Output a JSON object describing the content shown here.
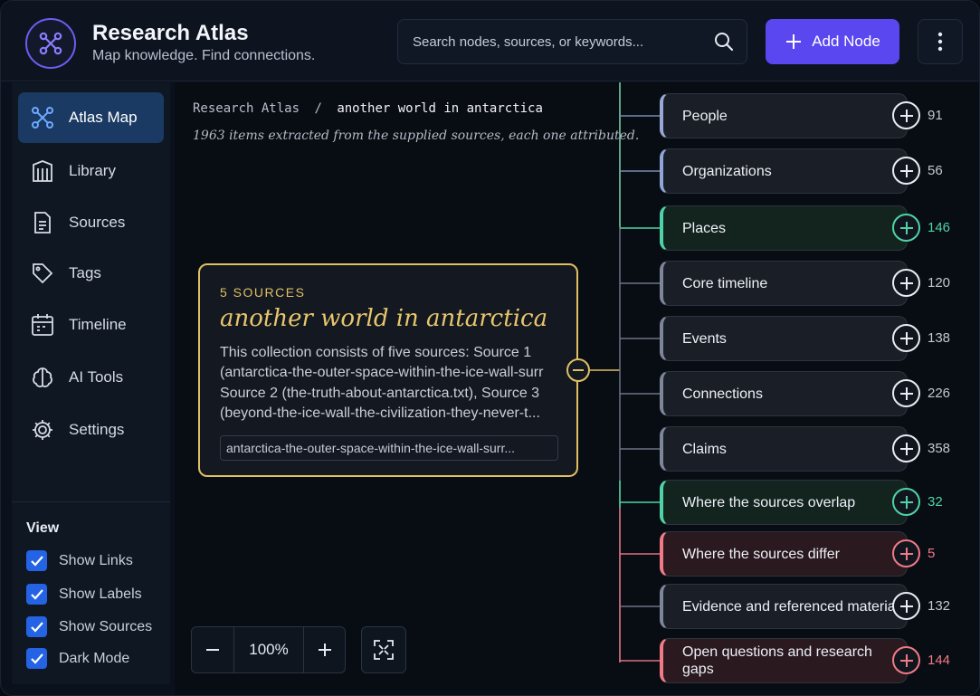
{
  "header": {
    "title": "Research Atlas",
    "subtitle": "Map knowledge. Find connections.",
    "search_placeholder": "Search nodes, sources, or keywords...",
    "add_label": "Add Node"
  },
  "sidebar": {
    "items": [
      {
        "label": "Atlas Map",
        "icon": "network-icon"
      },
      {
        "label": "Library",
        "icon": "library-icon"
      },
      {
        "label": "Sources",
        "icon": "document-icon"
      },
      {
        "label": "Tags",
        "icon": "tag-icon"
      },
      {
        "label": "Timeline",
        "icon": "calendar-icon"
      },
      {
        "label": "AI Tools",
        "icon": "ai-icon"
      },
      {
        "label": "Settings",
        "icon": "gear-icon"
      }
    ],
    "view_title": "View",
    "view_options": [
      {
        "label": "Show Links",
        "checked": true
      },
      {
        "label": "Show Labels",
        "checked": true
      },
      {
        "label": "Show Sources",
        "checked": true
      },
      {
        "label": "Dark Mode",
        "checked": true
      }
    ]
  },
  "breadcrumb": {
    "root": "Research Atlas",
    "separator": "/",
    "current": "another world in antarctica"
  },
  "items_note": "1963 items extracted from the supplied sources, each one attributed.",
  "root_node": {
    "kicker": "5 SOURCES",
    "title": "another world in antarctica",
    "desc_lines": [
      "This collection consists of five sources: Source 1",
      "(antarctica-the-outer-space-within-the-ice-wall-surr",
      "Source 2 (the-truth-about-antarctica.txt), Source 3",
      "(beyond-the-ice-wall-the-civilization-they-never-t..."
    ],
    "file": "antarctica-the-outer-space-within-the-ice-wall-surr..."
  },
  "branches": [
    {
      "label": "People",
      "count": "91",
      "accent": "#9aa8d8",
      "tint": "#1a1f27"
    },
    {
      "label": "Organizations",
      "count": "56",
      "accent": "#8fa6d6",
      "tint": "#1a1f27"
    },
    {
      "label": "Places",
      "count": "146",
      "accent": "#4fd3a5",
      "tint": "#13241f"
    },
    {
      "label": "Core timeline",
      "count": "120",
      "accent": "#7d8799",
      "tint": "#1a1f27"
    },
    {
      "label": "Events",
      "count": "138",
      "accent": "#7d8799",
      "tint": "#1a1f27"
    },
    {
      "label": "Connections",
      "count": "226",
      "accent": "#7d8799",
      "tint": "#1a1f27"
    },
    {
      "label": "Claims",
      "count": "358",
      "accent": "#7d8799",
      "tint": "#1a1f27"
    },
    {
      "label": "Where the sources overlap",
      "count": "32",
      "accent": "#4fd3a5",
      "tint": "#13241f"
    },
    {
      "label": "Where the sources differ",
      "count": "5",
      "accent": "#f07a86",
      "tint": "#2a1a20"
    },
    {
      "label": "Evidence and referenced materials",
      "count": "132",
      "accent": "#7d8799",
      "tint": "#1a1f27"
    },
    {
      "label": "Open questions and research gaps",
      "count": "144",
      "accent": "#f07a86",
      "tint": "#2a1a20"
    }
  ],
  "zoom": {
    "value": "100%"
  },
  "colors": {
    "brand": "#5b47f0",
    "root_accent": "#e0bf64",
    "active_nav": "#1a3a63"
  }
}
